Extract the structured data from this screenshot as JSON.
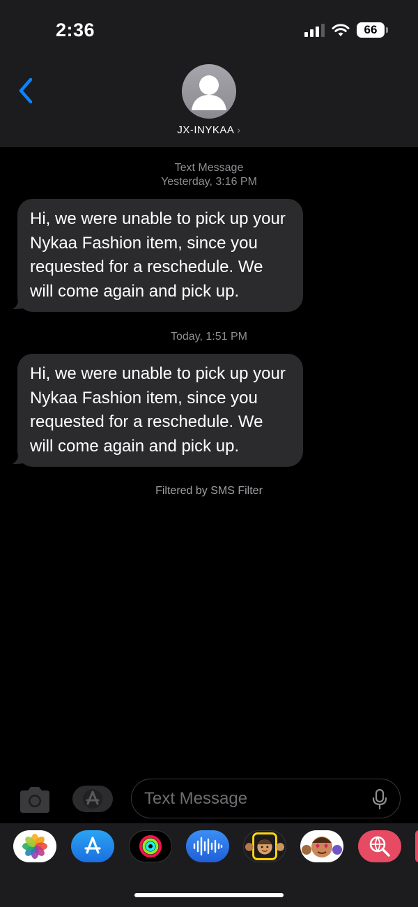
{
  "status_bar": {
    "time": "2:36",
    "battery": "66"
  },
  "header": {
    "contact_name": "JX-INYKAA",
    "chevron": "›"
  },
  "conversation": {
    "messages": [
      {
        "timestamp_line1": "Text Message",
        "timestamp_line2": "Yesterday, 3:16 PM",
        "text": "Hi, we were unable to pick up your Nykaa Fashion item,  since you requested for a reschedule. We will come again and pick up."
      },
      {
        "timestamp_line1": "",
        "timestamp_line2": "Today, 1:51 PM",
        "text": "Hi, we were unable to pick up your Nykaa Fashion item,  since you requested for a reschedule. We will come again and pick up."
      }
    ],
    "filter_note": "Filtered by SMS Filter"
  },
  "compose": {
    "placeholder": "Text Message"
  },
  "app_drawer": {
    "apps": [
      "photos-icon",
      "app-store-icon",
      "activity-icon",
      "audio-message-icon",
      "memoji-stickers-icon",
      "animoji-icon",
      "web-search-icon"
    ]
  },
  "colors": {
    "accent_blue": "#0a84ff",
    "bubble_gray": "#2b2b2e",
    "header_bg": "#1c1c1e"
  }
}
